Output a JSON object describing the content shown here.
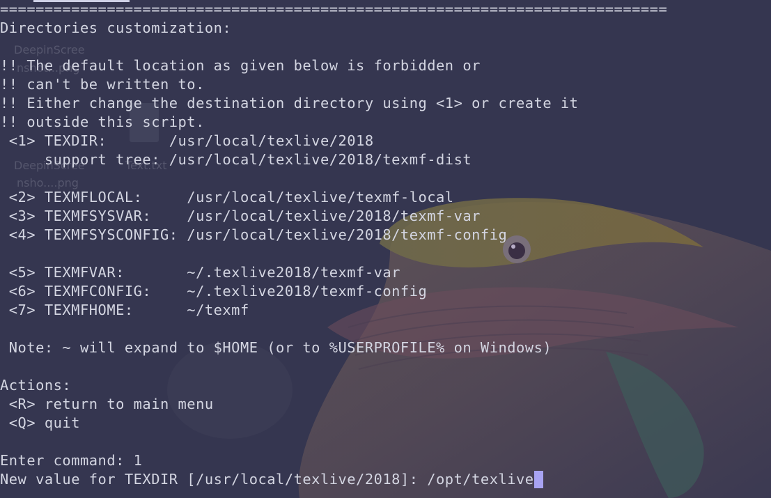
{
  "desktop": {
    "icons": [
      {
        "label": "DeepinScree"
      },
      {
        "label": "nshot...png"
      },
      {
        "label": "DeepinScree"
      },
      {
        "label": "nsho....png"
      },
      {
        "label": "Text.txt"
      }
    ],
    "colors": {
      "background": "#353650",
      "text": "#d3d5e1",
      "cursor": "#a8a3f2"
    }
  },
  "terminal": {
    "lines": [
      "===========================================================================",
      "Directories customization:",
      "",
      "!! The default location as given below is forbidden or",
      "!! can't be written to.",
      "!! Either change the destination directory using <1> or create it",
      "!! outside this script.",
      " <1> TEXDIR:       /usr/local/texlive/2018",
      "     support tree: /usr/local/texlive/2018/texmf-dist",
      "",
      " <2> TEXMFLOCAL:     /usr/local/texlive/texmf-local",
      " <3> TEXMFSYSVAR:    /usr/local/texlive/2018/texmf-var",
      " <4> TEXMFSYSCONFIG: /usr/local/texlive/2018/texmf-config",
      "",
      " <5> TEXMFVAR:       ~/.texlive2018/texmf-var",
      " <6> TEXMFCONFIG:    ~/.texlive2018/texmf-config",
      " <7> TEXMFHOME:      ~/texmf",
      "",
      " Note: ~ will expand to $HOME (or to %USERPROFILE% on Windows)",
      "",
      "Actions:",
      " <R> return to main menu",
      " <Q> quit",
      "",
      "Enter command: 1",
      "New value for TEXDIR [/usr/local/texlive/2018]: /opt/texlive"
    ]
  }
}
